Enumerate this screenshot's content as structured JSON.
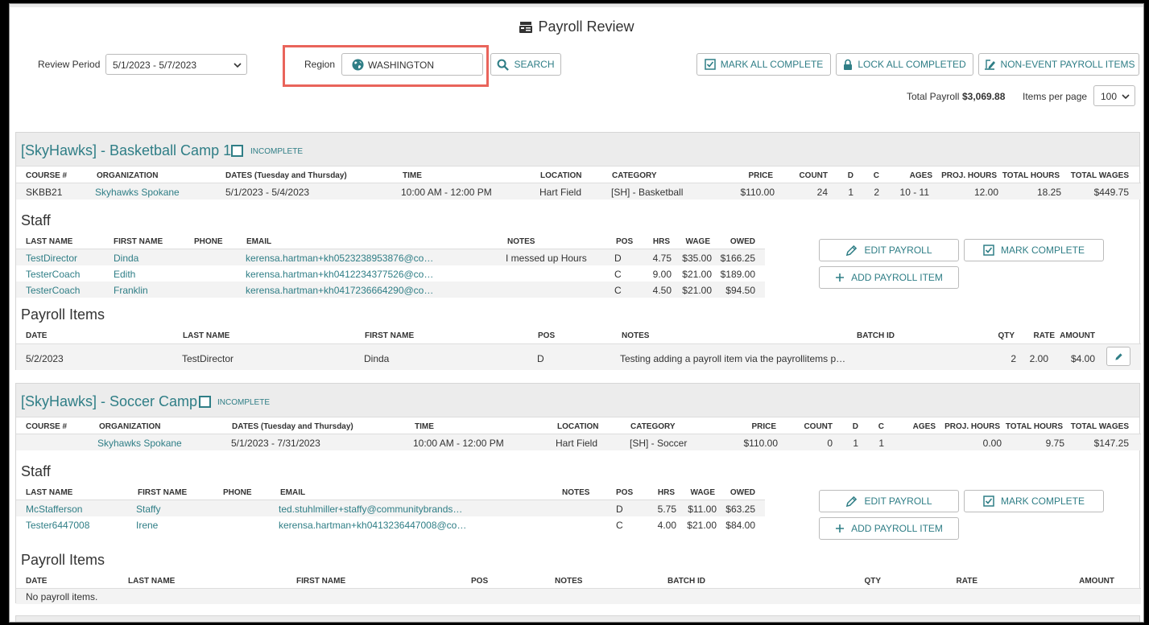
{
  "page": {
    "title": "Payroll Review"
  },
  "filters": {
    "review_period_label": "Review Period",
    "review_period_value": "5/1/2023 - 5/7/2023",
    "region_label": "Region",
    "region_value": "WASHINGTON",
    "search_label": "SEARCH"
  },
  "toolbar": {
    "mark_all_complete": "MARK ALL COMPLETE",
    "lock_all_completed": "LOCK ALL COMPLETED",
    "non_event_payroll_items": "NON-EVENT PAYROLL ITEMS"
  },
  "summary": {
    "total_payroll_label": "Total Payroll",
    "total_payroll_value": "$3,069.88",
    "items_per_page_label": "Items per page",
    "items_per_page_value": "100"
  },
  "colors": {
    "accent": "#2f7e86",
    "highlight": "#e9645b"
  },
  "labels": {
    "staff": "Staff",
    "payroll_items": "Payroll Items",
    "edit_payroll": "EDIT PAYROLL",
    "mark_complete": "MARK COMPLETE",
    "add_payroll_item": "ADD PAYROLL ITEM",
    "no_payroll_items": "No payroll items."
  },
  "course_headers": [
    "COURSE #",
    "ORGANIZATION",
    "DATES (Tuesday and Thursday)",
    "TIME",
    "LOCATION",
    "CATEGORY",
    "PRICE",
    "COUNT",
    "D",
    "C",
    "AGES",
    "PROJ. HOURS",
    "TOTAL HOURS",
    "TOTAL WAGES"
  ],
  "staff_headers": [
    "LAST NAME",
    "FIRST NAME",
    "PHONE",
    "EMAIL",
    "NOTES",
    "POS",
    "HRS",
    "WAGE",
    "OWED"
  ],
  "item_headers": [
    "DATE",
    "LAST NAME",
    "FIRST NAME",
    "POS",
    "NOTES",
    "BATCH ID",
    "QTY",
    "RATE",
    "AMOUNT"
  ],
  "events": [
    {
      "title": "[SkyHawks] - Basketball Camp 1",
      "status": "INCOMPLETE",
      "course": [
        "SKBB21",
        "Skyhawks Spokane",
        "5/1/2023 - 5/4/2023",
        "10:00 AM - 12:00 PM",
        "Hart Field",
        "[SH] - Basketball",
        "$110.00",
        "24",
        "1",
        "2",
        "10 - 11",
        "12.00",
        "18.25",
        "$449.75"
      ],
      "staff": [
        [
          "TestDirector",
          "Dinda",
          "",
          "kerensa.hartman+kh0523238953876@co…",
          "I messed up Hours",
          "D",
          "4.75",
          "$35.00",
          "$166.25"
        ],
        [
          "TesterCoach",
          "Edith",
          "",
          "kerensa.hartman+kh0412234377526@co…",
          "",
          "C",
          "9.00",
          "$21.00",
          "$189.00"
        ],
        [
          "TesterCoach",
          "Franklin",
          "",
          "kerensa.hartman+kh0417236664290@co…",
          "",
          "C",
          "4.50",
          "$21.00",
          "$94.50"
        ]
      ],
      "items": [
        [
          "5/2/2023",
          "TestDirector",
          "Dinda",
          "D",
          "Testing adding a payroll item via the payrollitems p…",
          "",
          "2",
          "2.00",
          "$4.00"
        ]
      ]
    },
    {
      "title": "[SkyHawks] - Soccer Camp",
      "status": "INCOMPLETE",
      "course": [
        "",
        "Skyhawks Spokane",
        "5/1/2023 - 7/31/2023",
        "10:00 AM - 12:00 PM",
        "Hart Field",
        "[SH] - Soccer",
        "$110.00",
        "0",
        "1",
        "1",
        "",
        "0.00",
        "9.75",
        "$147.25"
      ],
      "staff": [
        [
          "McStafferson",
          "Staffy",
          "",
          "ted.stuhlmiller+staffy@communitybrands…",
          "",
          "D",
          "5.75",
          "$11.00",
          "$63.25"
        ],
        [
          "Tester6447008",
          "Irene",
          "",
          "kerensa.hartman+kh0413236447008@co…",
          "",
          "C",
          "4.00",
          "$21.00",
          "$84.00"
        ]
      ],
      "items": []
    }
  ]
}
